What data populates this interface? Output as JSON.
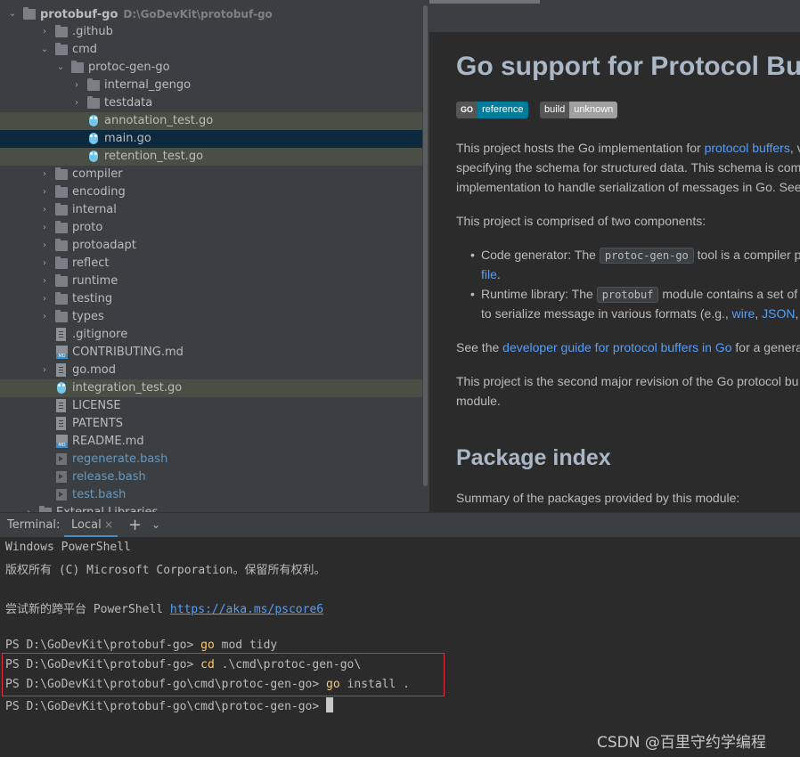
{
  "tree": {
    "root": {
      "name": "protobuf-go",
      "path": "D:\\GoDevKit\\protobuf-go"
    },
    "items": [
      {
        "label": ".github",
        "type": "folder",
        "arrow": "›",
        "state": ""
      },
      {
        "label": "cmd",
        "type": "folder",
        "arrow": "⌄",
        "state": ""
      },
      {
        "label": "protoc-gen-go",
        "type": "folder",
        "arrow": "⌄",
        "state": ""
      },
      {
        "label": "internal_gengo",
        "type": "folder",
        "arrow": "›",
        "state": ""
      },
      {
        "label": "testdata",
        "type": "folder",
        "arrow": "›",
        "state": ""
      },
      {
        "label": "annotation_test.go",
        "type": "go",
        "arrow": "",
        "state": "green"
      },
      {
        "label": "main.go",
        "type": "go",
        "arrow": "",
        "state": "blue"
      },
      {
        "label": "retention_test.go",
        "type": "go",
        "arrow": "",
        "state": "green"
      },
      {
        "label": "compiler",
        "type": "folder",
        "arrow": "›",
        "state": ""
      },
      {
        "label": "encoding",
        "type": "folder",
        "arrow": "›",
        "state": ""
      },
      {
        "label": "internal",
        "type": "folder",
        "arrow": "›",
        "state": ""
      },
      {
        "label": "proto",
        "type": "folder",
        "arrow": "›",
        "state": ""
      },
      {
        "label": "protoadapt",
        "type": "folder",
        "arrow": "›",
        "state": ""
      },
      {
        "label": "reflect",
        "type": "folder",
        "arrow": "›",
        "state": ""
      },
      {
        "label": "runtime",
        "type": "folder",
        "arrow": "›",
        "state": ""
      },
      {
        "label": "testing",
        "type": "folder",
        "arrow": "›",
        "state": ""
      },
      {
        "label": "types",
        "type": "folder",
        "arrow": "›",
        "state": ""
      },
      {
        "label": ".gitignore",
        "type": "text",
        "arrow": "",
        "state": ""
      },
      {
        "label": "CONTRIBUTING.md",
        "type": "md",
        "arrow": "",
        "state": ""
      },
      {
        "label": "go.mod",
        "type": "text",
        "arrow": "›",
        "state": ""
      },
      {
        "label": "integration_test.go",
        "type": "go",
        "arrow": "",
        "state": "green"
      },
      {
        "label": "LICENSE",
        "type": "text",
        "arrow": "",
        "state": ""
      },
      {
        "label": "PATENTS",
        "type": "text",
        "arrow": "",
        "state": ""
      },
      {
        "label": "README.md",
        "type": "md",
        "arrow": "",
        "state": ""
      },
      {
        "label": "regenerate.bash",
        "type": "sh",
        "arrow": "",
        "state": "bluetext"
      },
      {
        "label": "release.bash",
        "type": "sh",
        "arrow": "",
        "state": "bluetext"
      },
      {
        "label": "test.bash",
        "type": "sh",
        "arrow": "",
        "state": "bluetext"
      },
      {
        "label": "External Libraries",
        "type": "lib",
        "arrow": "›",
        "state": ""
      }
    ]
  },
  "preview": {
    "title": "Go support for Protocol Bu",
    "badges": [
      {
        "left": "GO",
        "right": "reference",
        "left_color": "#555555",
        "right_color": "#007d9c"
      },
      {
        "left": "build",
        "right": "unknown",
        "left_color": "#555555",
        "right_color": "#9f9f9f"
      }
    ],
    "para1": {
      "line1_pre": "This project hosts the Go implementation for ",
      "line1_link": "protocol buffers",
      "line1_post": ", v",
      "line2": "specifying the schema for structured data. This schema is com",
      "line3": "implementation to handle serialization of messages in Go. See"
    },
    "para2": "This project is comprised of two components:",
    "bullet1": {
      "pre": "Code generator: The ",
      "code": "protoc-gen-go",
      "post": " tool is a compiler p",
      "line2_link": "file",
      "line2_post": "."
    },
    "bullet2": {
      "pre": "Runtime library: The ",
      "code": "protobuf",
      "post": " module contains a set of",
      "line2_pre": "to serialize message in various formats (e.g., ",
      "link_wire": "wire",
      "sep": ", ",
      "link_json": "JSON",
      "line2_post": ","
    },
    "para3": {
      "pre": "See the ",
      "link": "developer guide for protocol buffers in Go",
      "post": " for a genera"
    },
    "para4": {
      "line1": "This project is the second major revision of the Go protocol bu",
      "line2": "module."
    },
    "h2": "Package index",
    "para5": "Summary of the packages provided by this module:"
  },
  "terminal": {
    "title": "Terminal:",
    "tab_label": "Local",
    "tab_close": "×",
    "add": "+",
    "more": "⌄",
    "lines": {
      "l1": "Windows PowerShell",
      "l2": "版权所有 (C) Microsoft Corporation。保留所有权利。",
      "l3_pre": "尝试新的跨平台 PowerShell ",
      "l3_link": "https://aka.ms/pscore6",
      "prompt1": "PS D:\\GoDevKit\\protobuf-go> ",
      "cmd1_kw": "go",
      "cmd1_rest": " mod tidy",
      "prompt2": "PS D:\\GoDevKit\\protobuf-go> ",
      "cmd2_kw": "cd",
      "cmd2_rest": " .\\cmd\\protoc-gen-go\\",
      "prompt3": "PS D:\\GoDevKit\\protobuf-go\\cmd\\protoc-gen-go> ",
      "cmd3_kw": "go",
      "cmd3_rest": " install .",
      "prompt4": "PS D:\\GoDevKit\\protobuf-go\\cmd\\protoc-gen-go> "
    }
  },
  "watermark": "CSDN @百里守约学编程"
}
